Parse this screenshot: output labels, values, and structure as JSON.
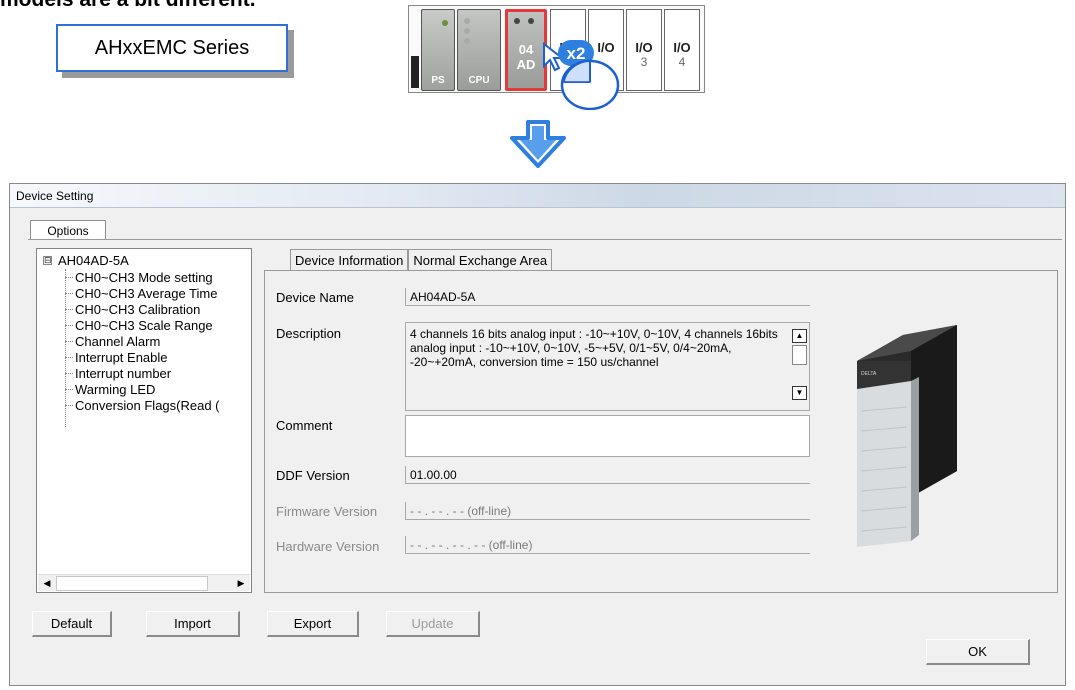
{
  "top_caption": "models are a bit different.",
  "series_label": "AHxxEMC Series",
  "rack": {
    "ps_label": "PS",
    "cpu_label": "CPU",
    "ad_label_top": "04",
    "ad_label_bottom": "AD",
    "slots": [
      {
        "label": "I/O",
        "num": ""
      },
      {
        "label": "I/O",
        "num": ""
      },
      {
        "label": "I/O",
        "num": "3"
      },
      {
        "label": "I/O",
        "num": "4"
      }
    ],
    "click_badge": "x2",
    "highlight_color": "#e23a3a"
  },
  "arrow_color": "#2f7fe0",
  "dialog": {
    "title": "Device Setting",
    "options_tab": "Options",
    "tree": {
      "root_expander": "⊟",
      "root": "AH04AD-5A",
      "children": [
        "CH0~CH3 Mode setting",
        "CH0~CH3 Average Time",
        "CH0~CH3 Calibration",
        "CH0~CH3 Scale Range",
        "Channel Alarm",
        "Interrupt Enable",
        "Interrupt number",
        "Warming LED",
        "Conversion Flags(Read ("
      ]
    },
    "tabs": [
      "Device Information",
      "Normal Exchange Area"
    ],
    "fields": {
      "device_name_label": "Device Name",
      "device_name_value": "AH04AD-5A",
      "description_label": "Description",
      "description_value": "4 channels 16 bits analog input : -10~+10V, 0~10V, 4 channels 16bits analog input : -10~+10V, 0~10V, -5~+5V, 0/1~5V, 0/4~20mA, -20~+20mA, conversion time = 150 us/channel",
      "comment_label": "Comment",
      "comment_value": "",
      "ddf_version_label": "DDF Version",
      "ddf_version_value": "01.00.00",
      "firmware_version_label": "Firmware Version",
      "firmware_version_value": "- - . - - . - - (off-line)",
      "hardware_version_label": "Hardware Version",
      "hardware_version_value": "- - . - - . - - . - - (off-line)"
    },
    "buttons": {
      "default": "Default",
      "import": "Import",
      "export": "Export",
      "update": "Update",
      "ok": "OK"
    }
  }
}
